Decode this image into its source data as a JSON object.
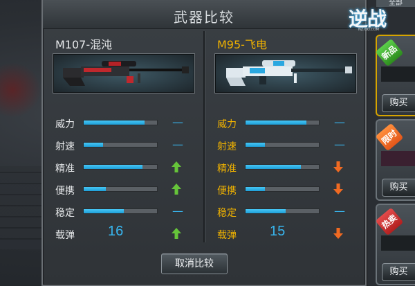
{
  "dialog": {
    "title": "武器比较",
    "cancel_label": "取消比较"
  },
  "weapons": [
    {
      "name": "M107-混沌",
      "image_icon": "sniper-rifle-red-icon",
      "stats": [
        {
          "label": "威力",
          "fill": 0.83,
          "compare": "same"
        },
        {
          "label": "射速",
          "fill": 0.26,
          "compare": "same"
        },
        {
          "label": "精准",
          "fill": 0.8,
          "compare": "up"
        },
        {
          "label": "便携",
          "fill": 0.3,
          "compare": "up"
        },
        {
          "label": "稳定",
          "fill": 0.55,
          "compare": "same"
        }
      ],
      "ammo": {
        "label": "载弹",
        "value": "16",
        "compare": "up"
      }
    },
    {
      "name": "M95-飞电",
      "image_icon": "sniper-rifle-blue-icon",
      "stats": [
        {
          "label": "威力",
          "fill": 0.83,
          "compare": "same"
        },
        {
          "label": "射速",
          "fill": 0.26,
          "compare": "same"
        },
        {
          "label": "精准",
          "fill": 0.75,
          "compare": "down"
        },
        {
          "label": "便携",
          "fill": 0.26,
          "compare": "down"
        },
        {
          "label": "稳定",
          "fill": 0.55,
          "compare": "same"
        }
      ],
      "ammo": {
        "label": "载弹",
        "value": "15",
        "compare": "down"
      }
    }
  ],
  "compare_symbols": {
    "same": "—"
  },
  "colors": {
    "bar": "#2fb4ec",
    "up": "#66c43a",
    "down": "#f06a22",
    "accent_gold": "#f0b200"
  },
  "sidebar": {
    "logo_text": "逆战",
    "logo_sub": "NZ.QQ.COM",
    "tab_label": "全部",
    "cards": [
      {
        "ribbon": "新品",
        "ribbon_color": "green",
        "buy_label": "购买",
        "featured": true
      },
      {
        "ribbon": "限时",
        "ribbon_color": "orange",
        "buy_label": "购买",
        "featured": false
      },
      {
        "ribbon": "热卖",
        "ribbon_color": "red",
        "buy_label": "购买",
        "featured": false
      }
    ]
  }
}
